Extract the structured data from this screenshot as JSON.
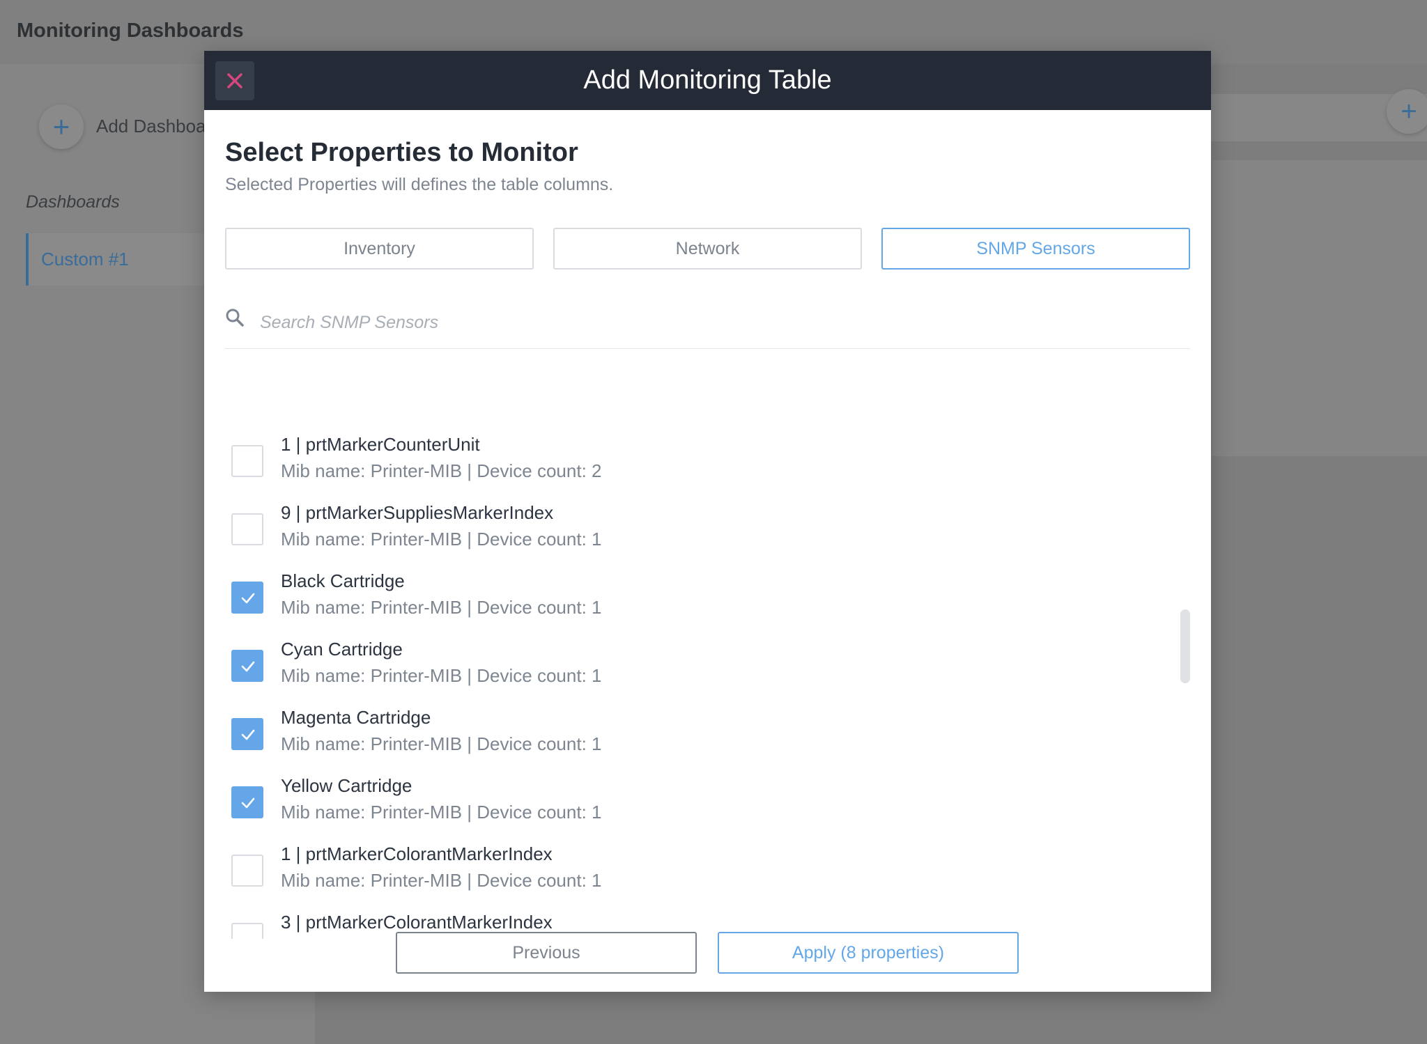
{
  "app": {
    "title": "Monitoring Dashboards",
    "add_dashboard_label": "Add Dashboa",
    "dashboards_section": "Dashboards",
    "dashboard_items": [
      "Custom #1"
    ]
  },
  "modal": {
    "title": "Add Monitoring Table",
    "heading": "Select Properties to Monitor",
    "subheading": "Selected Properties will defines the table columns.",
    "tabs": [
      {
        "label": "Inventory",
        "active": false
      },
      {
        "label": "Network",
        "active": false
      },
      {
        "label": "SNMP Sensors",
        "active": true
      }
    ],
    "search": {
      "placeholder": "Search SNMP Sensors",
      "value": ""
    },
    "items": [
      {
        "name": "1 | prtMarkerCounterUnit",
        "meta": "Mib name: Printer-MIB | Device count: 2",
        "checked": false
      },
      {
        "name": "9 | prtMarkerSuppliesMarkerIndex",
        "meta": "Mib name: Printer-MIB | Device count: 1",
        "checked": false
      },
      {
        "name": "Black Cartridge",
        "meta": "Mib name: Printer-MIB | Device count: 1",
        "checked": true
      },
      {
        "name": "Cyan Cartridge",
        "meta": "Mib name: Printer-MIB | Device count: 1",
        "checked": true
      },
      {
        "name": "Magenta Cartridge",
        "meta": "Mib name: Printer-MIB | Device count: 1",
        "checked": true
      },
      {
        "name": "Yellow Cartridge",
        "meta": "Mib name: Printer-MIB | Device count: 1",
        "checked": true
      },
      {
        "name": "1 | prtMarkerColorantMarkerIndex",
        "meta": "Mib name: Printer-MIB | Device count: 1",
        "checked": false
      },
      {
        "name": "3 | prtMarkerColorantMarkerIndex",
        "meta": "",
        "checked": false
      }
    ],
    "buttons": {
      "previous": "Previous",
      "apply": "Apply (8 properties)"
    }
  },
  "colors": {
    "accent": "#63a7e6",
    "header_bg": "#242b36",
    "close_icon": "#d6477e"
  }
}
